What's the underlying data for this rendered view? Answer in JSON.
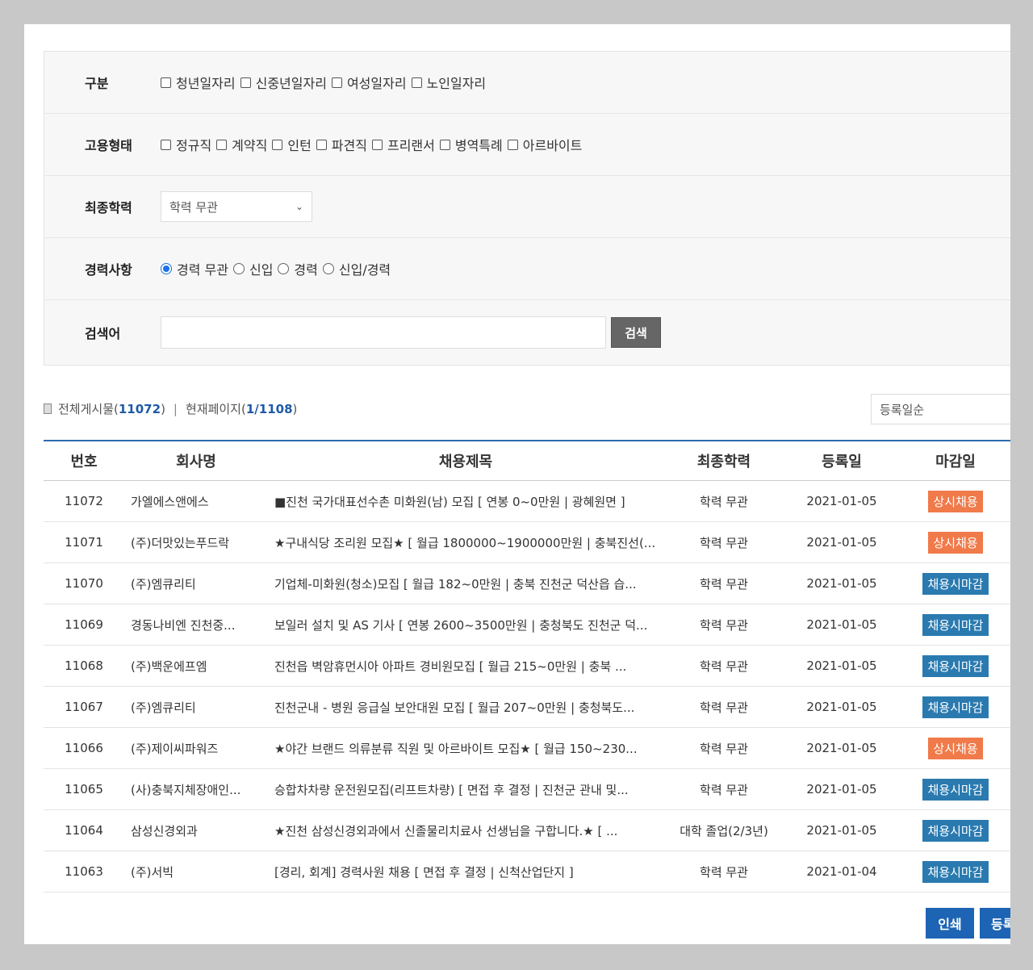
{
  "filters": {
    "category": {
      "label": "구분",
      "options": [
        "청년일자리",
        "신중년일자리",
        "여성일자리",
        "노인일자리"
      ]
    },
    "employment": {
      "label": "고용형태",
      "options": [
        "정규직",
        "계약직",
        "인턴",
        "파견직",
        "프리랜서",
        "병역특례",
        "아르바이트"
      ]
    },
    "education": {
      "label": "최종학력",
      "selected": "학력 무관"
    },
    "career": {
      "label": "경력사항",
      "options": [
        "경력 무관",
        "신입",
        "경력",
        "신입/경력"
      ],
      "selected_index": 0
    },
    "search": {
      "label": "검색어",
      "value": "",
      "button": "검색"
    }
  },
  "info": {
    "total_label": "전체게시물",
    "total": "11072",
    "page_label": "현재페이지",
    "page": "1/1108"
  },
  "sort": {
    "selected": "등록일순"
  },
  "table": {
    "headers": {
      "no": "번호",
      "company": "회사명",
      "title": "채용제목",
      "education": "최종학력",
      "date": "등록일",
      "deadline": "마감일"
    },
    "rows": [
      {
        "no": "11072",
        "company": "가엘에스앤에스",
        "title": "■진천 국가대표선수촌 미화원(남) 모집 [ 연봉 0~0만원 | 광혜원면 ]",
        "education": "학력 무관",
        "date": "2021-01-05",
        "deadline": "상시채용",
        "type": "open"
      },
      {
        "no": "11071",
        "company": "(주)더맛있는푸드락",
        "title": "★구내식당 조리원 모집★ [ 월급 1800000~1900000만원 | 충북진선(...",
        "education": "학력 무관",
        "date": "2021-01-05",
        "deadline": "상시채용",
        "type": "open"
      },
      {
        "no": "11070",
        "company": "(주)엠큐리티",
        "title": "기업체-미화원(청소)모집 [ 월급 182~0만원 | 충북 진천군 덕산읍 습...",
        "education": "학력 무관",
        "date": "2021-01-05",
        "deadline": "채용시마감",
        "type": "close"
      },
      {
        "no": "11069",
        "company": "경동나비엔 진천중...",
        "title": "보일러 설치 및 AS 기사 [ 연봉 2600~3500만원 | 충청북도 진천군 덕...",
        "education": "학력 무관",
        "date": "2021-01-05",
        "deadline": "채용시마감",
        "type": "close"
      },
      {
        "no": "11068",
        "company": "(주)백운에프엠",
        "title": "진천읍 벽암휴먼시아 아파트 경비원모집 [ 월급 215~0만원 | 충북 ...",
        "education": "학력 무관",
        "date": "2021-01-05",
        "deadline": "채용시마감",
        "type": "close"
      },
      {
        "no": "11067",
        "company": "(주)엠큐리티",
        "title": "진천군내 - 병원 응급실 보안대원 모집 [ 월급 207~0만원 | 충청북도...",
        "education": "학력 무관",
        "date": "2021-01-05",
        "deadline": "채용시마감",
        "type": "close"
      },
      {
        "no": "11066",
        "company": "(주)제이씨파워즈",
        "title": "★야간 브랜드 의류분류 직원 및 아르바이트 모집★ [ 월급 150~230...",
        "education": "학력 무관",
        "date": "2021-01-05",
        "deadline": "상시채용",
        "type": "open"
      },
      {
        "no": "11065",
        "company": "(사)충북지체장애인...",
        "title": "승합차차량 운전원모집(리프트차량) [ 면접 후 결정 | 진천군 관내 및...",
        "education": "학력 무관",
        "date": "2021-01-05",
        "deadline": "채용시마감",
        "type": "close"
      },
      {
        "no": "11064",
        "company": "삼성신경외과",
        "title": "★진천 삼성신경외과에서 신졸물리치료사 선생님을 구합니다.★ [ ...",
        "education": "대학 졸업(2/3년)",
        "date": "2021-01-05",
        "deadline": "채용시마감",
        "type": "close"
      },
      {
        "no": "11063",
        "company": "(주)서빅",
        "title": "[경리, 회계] 경력사원 채용 [ 면접 후 결정 | 신척산업단지 ]",
        "education": "학력 무관",
        "date": "2021-01-04",
        "deadline": "채용시마감",
        "type": "close"
      }
    ]
  },
  "buttons": {
    "print": "인쇄",
    "register": "등록"
  }
}
